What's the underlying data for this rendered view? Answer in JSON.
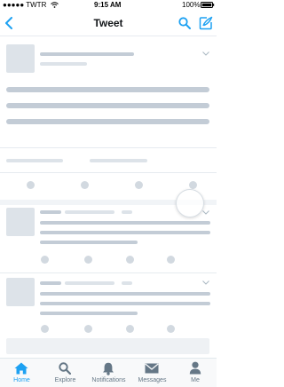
{
  "status_bar": {
    "carrier": "●●●●● TWTR",
    "time": "9:15 AM",
    "battery": "100%"
  },
  "nav": {
    "title": "Tweet"
  },
  "tabs": [
    {
      "label": "Home",
      "icon": "home-icon",
      "active": true
    },
    {
      "label": "Explore",
      "icon": "search-icon",
      "active": false
    },
    {
      "label": "Notifications",
      "icon": "bell-icon",
      "active": false
    },
    {
      "label": "Messages",
      "icon": "envelope-icon",
      "active": false
    },
    {
      "label": "Me",
      "icon": "person-icon",
      "active": false
    }
  ],
  "colors": {
    "accent": "#1da1f2",
    "placeholder": "#c3ccd6",
    "placeholder_light": "#dde3e9",
    "inactive_tab": "#657786"
  }
}
